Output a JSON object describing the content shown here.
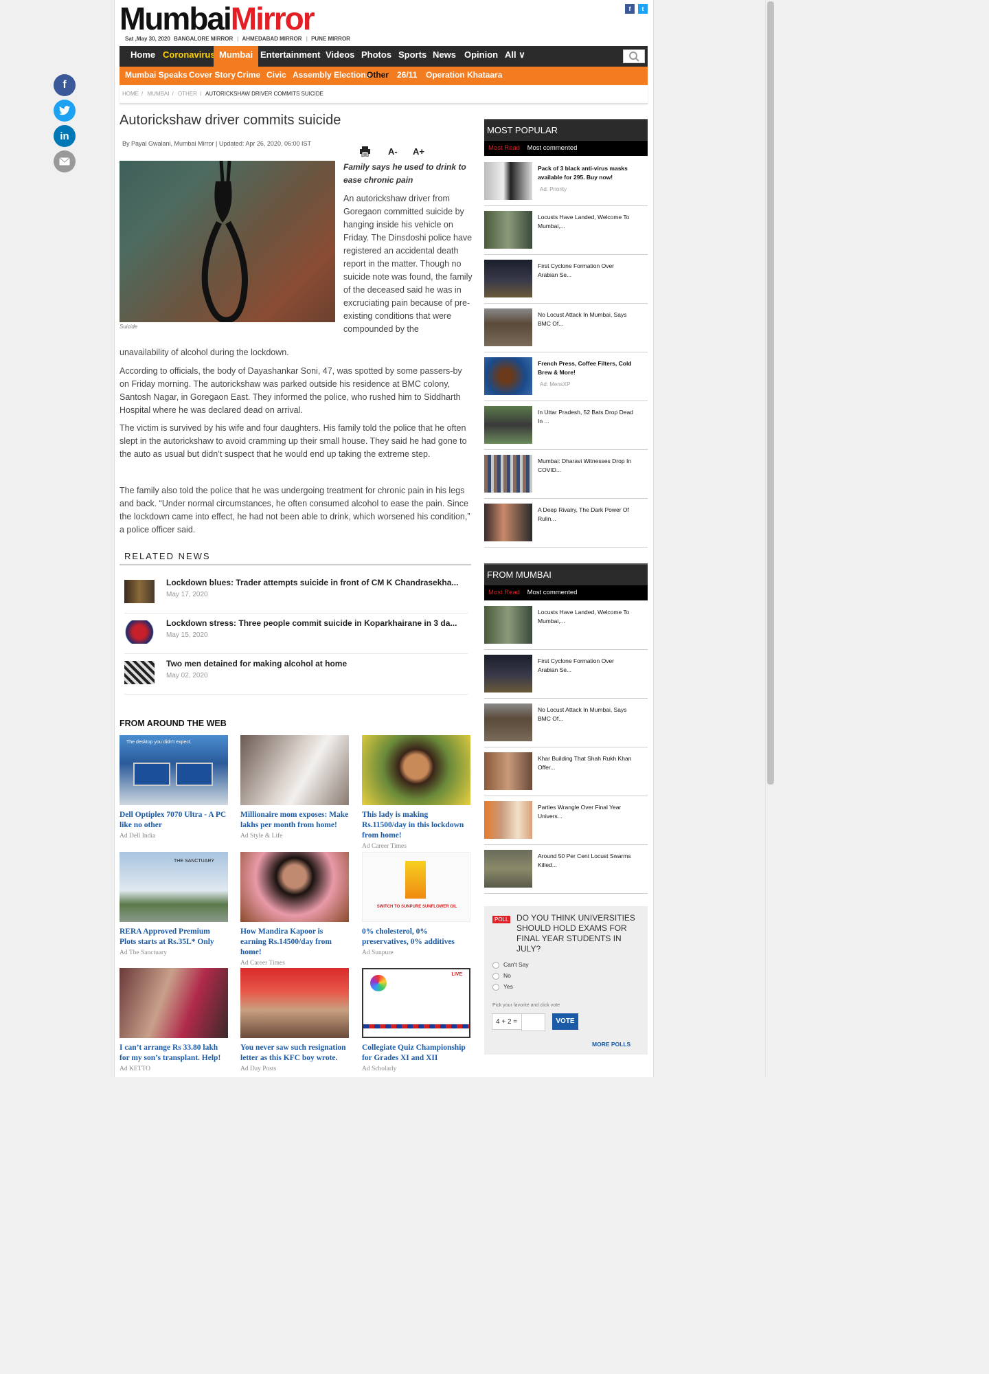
{
  "header": {
    "logo_part1": "Mumbai",
    "logo_part2": "Mirror",
    "date": "Sat ,May 30, 2020",
    "editions": [
      "BANGALORE MIRROR",
      "AHMEDABAD MIRROR",
      "PUNE MIRROR"
    ],
    "top_social": [
      "f",
      "t"
    ]
  },
  "nav": {
    "items": [
      "Home",
      "Coronavirus",
      "Mumbai",
      "Entertainment",
      "Videos",
      "Photos",
      "Sports",
      "News",
      "Opinion",
      "All"
    ],
    "active": "Mumbai",
    "search_icon": "search-icon"
  },
  "subnav": {
    "items": [
      "Mumbai Speaks",
      "Cover Story",
      "Crime",
      "Civic",
      "Assembly Elections",
      "Other",
      "26/11",
      "Operation Khataara"
    ],
    "active": "Other"
  },
  "breadcrumb": [
    "HOME",
    "MUMBAI",
    "OTHER",
    "AUTORICKSHAW DRIVER COMMITS SUICIDE"
  ],
  "share": {
    "icons": [
      "facebook-icon",
      "twitter-icon",
      "linkedin-icon",
      "email-icon"
    ],
    "colors": {
      "facebook": "#3b5998",
      "twitter": "#1da1f2",
      "linkedin": "#0077b5",
      "email": "#999999"
    }
  },
  "article": {
    "title": "Autorickshaw driver commits suicide",
    "byline": "By Payal Gwalani, Mumbai Mirror | Updated: Apr 26, 2020, 06:00 IST",
    "tools": {
      "print_icon": "print-icon",
      "font_minus": "A-",
      "font_plus": "A+"
    },
    "image_caption": "Suicide",
    "teaser": "Family says he used to drink to ease chronic pain",
    "paragraphs": [
      "An autorickshaw driver from Goregaon committed suicide by hanging inside his vehicle on Friday. The Dinsdoshi police have registered an accidental death report in the matter. Though no suicide note was found, the family of the deceased said he was in excruciating pain because of pre-existing conditions that were compounded by the unavailability of alcohol during the lockdown.",
      "According to officials, the body of Dayashankar Soni, 47, was spotted by some passers-by on Friday morning. The autorickshaw was parked outside his residence at BMC colony, Santosh Nagar, in Goregaon East. They informed the police, who rushed him to Siddharth Hospital where he was declared dead on arrival.",
      "The victim is survived by his wife and four daughters. His family told the police that he often slept in the autorickshaw to avoid cramming up their small house. They said he had gone to the auto as usual but didn’t suspect that he would end up taking the extreme step.",
      "The family also told the police that he was undergoing treatment for chronic pain in his legs and back. “Under normal circumstances, he often consumed alcohol to ease the pain. Since the lockdown came into effect, he had not been able to drink, which worsened his condition,” a police officer said."
    ],
    "para1_side": "An autorickshaw driver from Goregaon committed suicide by hanging inside his vehicle on Friday. The Dinsdoshi police have registered an accidental death report in the matter. Though no suicide note was found, the family of the deceased said he was in excruciating pain because of pre-existing conditions that were compounded by the",
    "para1_tail": "unavailability of alcohol during the lockdown."
  },
  "related": {
    "heading": "RELATED NEWS",
    "items": [
      {
        "title": "Lockdown blues: Trader attempts suicide in front of CM K Chandrasekha...",
        "date": "May 17, 2020"
      },
      {
        "title": "Lockdown stress: Three people commit suicide in Koparkhairane in 3 da...",
        "date": "May 15, 2020"
      },
      {
        "title": "Two men detained for making alcohol at home",
        "date": "May 02, 2020"
      }
    ]
  },
  "around_web": {
    "heading": "FROM AROUND THE WEB",
    "cards": [
      {
        "title": "Dell Optiplex 7070 Ultra - A PC like no other",
        "ad": "Ad  Dell India",
        "img_text": "The desktop you didn't expect."
      },
      {
        "title": "Millionaire mom exposes: Make lakhs per month from home!",
        "ad": "Ad  Style & Life"
      },
      {
        "title": "This lady is making Rs.11500/day in this lockdown from home!",
        "ad": "Ad  Career Times"
      },
      {
        "title": "RERA Approved Premium Plots starts at Rs.35L* Only",
        "ad": "Ad  The Sanctuary",
        "img_text": "THE SANCTUARY"
      },
      {
        "title": "How Mandira Kapoor is earning Rs.14500/day from home!",
        "ad": "Ad  Career Times"
      },
      {
        "title": "0% cholesterol, 0% preservatives, 0% additives",
        "ad": "Ad  Sunpure",
        "img_text": "SWITCH TO SUNPURE SUNFLOWER OIL"
      },
      {
        "title": "I can’t arrange Rs 33.80 lakh for my son’s transplant. Help!",
        "ad": "Ad  KETTO"
      },
      {
        "title": "You never saw such resignation letter as this KFC boy wrote.",
        "ad": "Ad  Day Posts"
      },
      {
        "title": "Collegiate Quiz Championship for Grades XI and XII",
        "ad": "Ad  Scholarly",
        "img_text": "LIVE"
      }
    ]
  },
  "sidebar": {
    "most_popular": {
      "heading": "MOST POPULAR",
      "tabs": [
        "Most Read",
        "Most commented"
      ],
      "items": [
        {
          "title": "Pack of 3 black anti-virus masks available for 295. Buy now!",
          "ad_note": "Ad: Priority",
          "is_ad": true
        },
        {
          "title": "Locusts Have Landed, Welcome To Mumbai,..."
        },
        {
          "title": "First Cyclone Formation Over Arabian Se..."
        },
        {
          "title": "No Locust Attack In Mumbai, Says BMC Of..."
        },
        {
          "title": "French Press, Coffee Filters, Cold Brew & More!",
          "ad_note": "Ad: MensXP",
          "is_ad": true
        },
        {
          "title": "In Uttar Pradesh, 52 Bats Drop Dead In ..."
        },
        {
          "title": "Mumbai: Dharavi Witnesses Drop In COVID..."
        },
        {
          "title": "A Deep Rivalry, The Dark Power Of Rulin..."
        }
      ]
    },
    "from_mumbai": {
      "heading": "FROM MUMBAI",
      "tabs": [
        "Most Read",
        "Most commented"
      ],
      "items": [
        {
          "title": "Locusts Have Landed, Welcome To Mumbai,..."
        },
        {
          "title": "First Cyclone Formation Over Arabian Se..."
        },
        {
          "title": "No Locust Attack In Mumbai, Says BMC Of..."
        },
        {
          "title": "Khar Building That Shah Rukh Khan Offer..."
        },
        {
          "title": "Parties Wrangle Over Final Year Univers..."
        },
        {
          "title": "Around 50 Per Cent Locust Swarms Killed..."
        }
      ]
    },
    "poll": {
      "tag": "POLL",
      "question": "DO YOU THINK UNIVERSITIES SHOULD HOLD EXAMS FOR FINAL YEAR STUDENTS IN JULY?",
      "options": [
        "Can't Say",
        "No",
        "Yes"
      ],
      "hint": "Pick your favorite and click vote",
      "captcha": "4 + 2 =",
      "vote_label": "VOTE",
      "more_label": "MORE POLLS"
    }
  }
}
